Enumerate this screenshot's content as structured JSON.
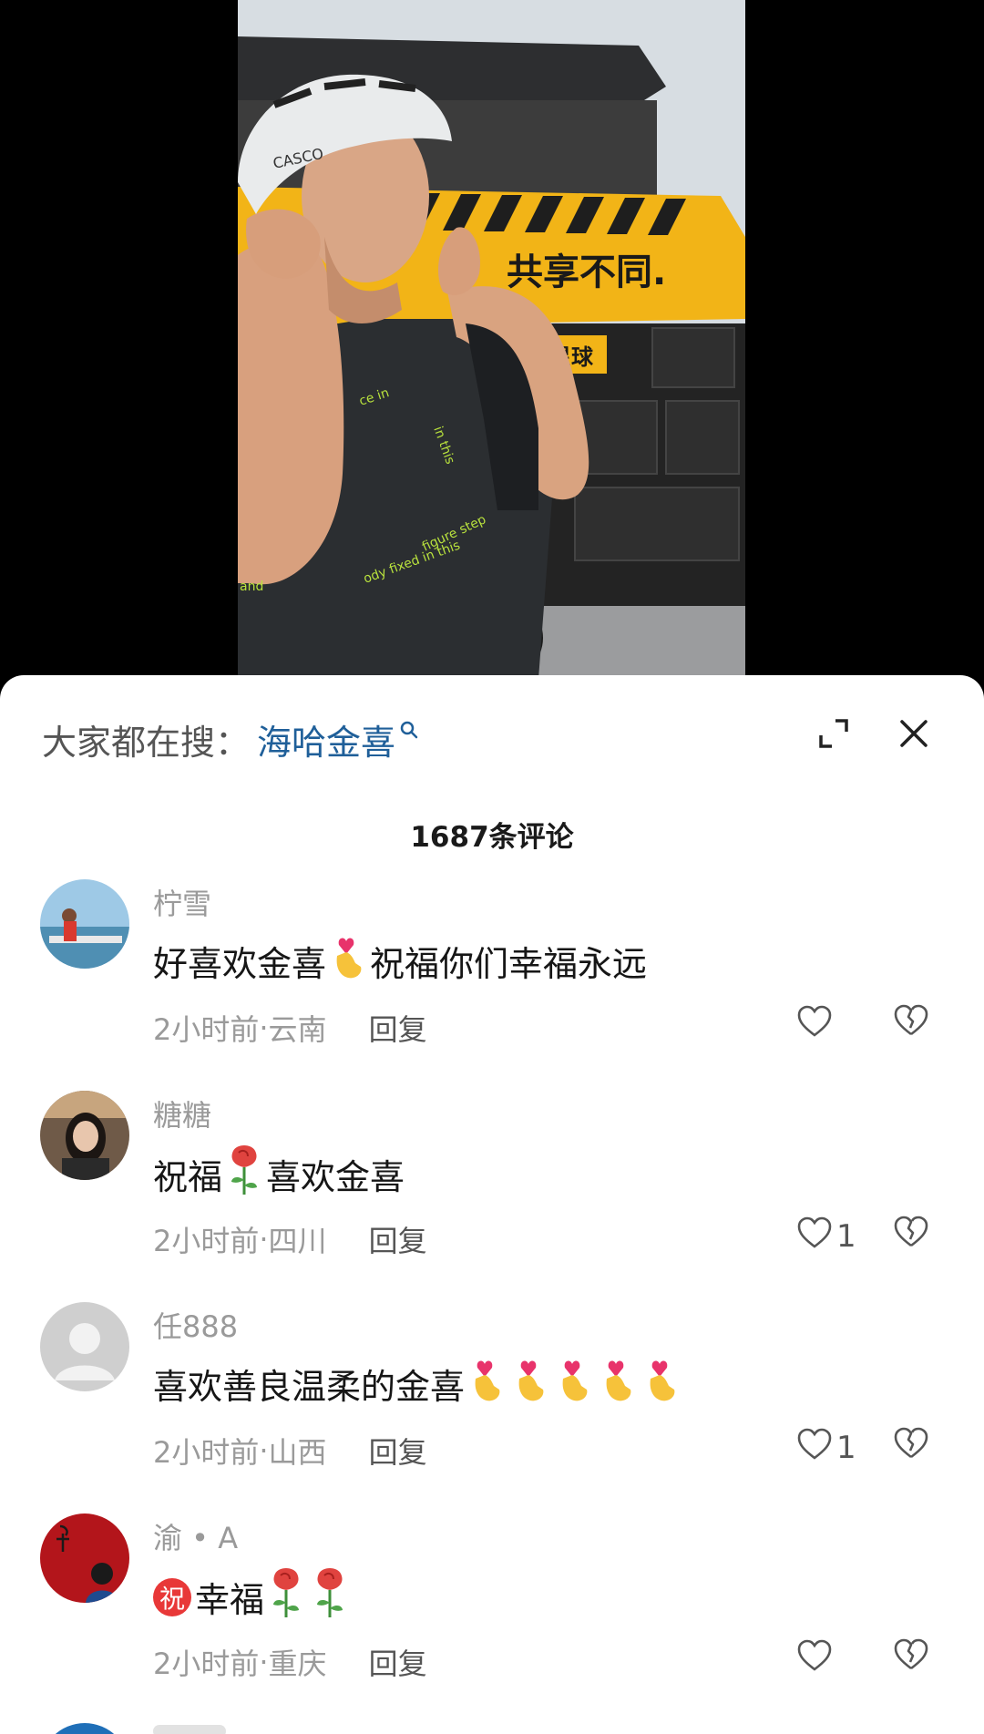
{
  "video": {
    "banner_text": "共享不同.",
    "sub_banner_text": "鹿星球",
    "helmet_brand": "CASCO",
    "jersey_text_1": "in this",
    "jersey_text_2": "ody fixed in this",
    "jersey_text_3": "figure step",
    "jersey_text_4": "and",
    "jersey_text_5": "ce in"
  },
  "search": {
    "prefix": "大家都在搜：",
    "term": "海哈金喜"
  },
  "header": {
    "comment_count": "1687条评论"
  },
  "comments": [
    {
      "username": "柠雪",
      "text_before": "好喜欢金喜",
      "text_after": "祝福你们幸福永远",
      "time": "2小时前",
      "location": "云南",
      "reply": "回复",
      "likes": ""
    },
    {
      "username": "糖糖",
      "text_before": "祝福",
      "text_after": "喜欢金喜",
      "time": "2小时前",
      "location": "四川",
      "reply": "回复",
      "likes": "1"
    },
    {
      "username": "任888",
      "text_before": "喜欢善良温柔的金喜",
      "text_after": "",
      "time": "2小时前",
      "location": "山西",
      "reply": "回复",
      "likes": "1"
    },
    {
      "username": "渝 • A",
      "badge": "祝",
      "text_before": "幸福",
      "text_after": "",
      "time": "2小时前",
      "location": "重庆",
      "reply": "回复",
      "likes": ""
    }
  ],
  "separator": " · ",
  "colors": {
    "accent_link": "#1f5f99",
    "badge_red": "#e83838",
    "banner_yellow": "#f2b417"
  },
  "icons": {
    "expand": "expand-icon",
    "close": "close-icon",
    "search": "search-icon",
    "like": "heart-outline-icon",
    "dislike": "broken-heart-icon",
    "finger_heart": "finger-heart-emoji",
    "rose": "rose-emoji"
  }
}
